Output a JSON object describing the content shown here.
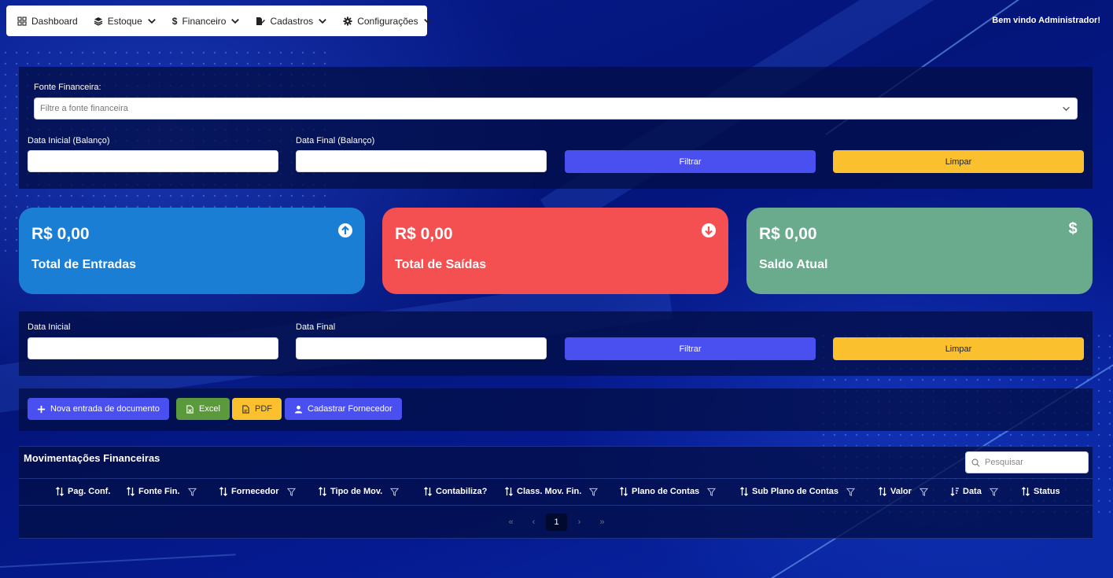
{
  "nav": {
    "items": [
      {
        "label": "Dashboard",
        "icon": "grid-icon"
      },
      {
        "label": "Estoque",
        "icon": "layers-icon"
      },
      {
        "label": "Financeiro",
        "icon": "dollar-icon"
      },
      {
        "label": "Cadastros",
        "icon": "file-edit-icon"
      },
      {
        "label": "Configurações",
        "icon": "gear-icon"
      }
    ],
    "welcome": "Bem vindo Administrador!"
  },
  "balance_filter": {
    "source_label": "Fonte Financeira:",
    "source_placeholder": "Filtre a fonte financeira",
    "start_label": "Data Inicial (Balanço)",
    "end_label": "Data Final (Balanço)",
    "filter_button": "Filtrar",
    "clear_button": "Limpar"
  },
  "cards": [
    {
      "amount": "R$ 0,00",
      "title": "Total de Entradas",
      "icon": "arrow-up-circle-icon",
      "color": "#1a7fd4"
    },
    {
      "amount": "R$ 0,00",
      "title": "Total de Saídas",
      "icon": "arrow-down-circle-icon",
      "color": "#f44f51"
    },
    {
      "amount": "R$ 0,00",
      "title": "Saldo Atual",
      "icon": "dollar-icon",
      "color": "#6aab8e"
    }
  ],
  "date_filter": {
    "start_label": "Data Inicial",
    "end_label": "Data Final",
    "filter_button": "Filtrar",
    "clear_button": "Limpar"
  },
  "actions": {
    "new_doc": "Nova entrada de documento",
    "excel": "Excel",
    "pdf": "PDF",
    "supplier": "Cadastrar Fornecedor"
  },
  "table": {
    "title": "Movimentações Financeiras",
    "search_placeholder": "Pesquisar",
    "columns": [
      {
        "label": "Pag. Conf.",
        "filter": false,
        "sort": "both"
      },
      {
        "label": "Fonte Fin.",
        "filter": true,
        "sort": "both"
      },
      {
        "label": "Fornecedor",
        "filter": true,
        "sort": "both"
      },
      {
        "label": "Tipo de Mov.",
        "filter": true,
        "sort": "both"
      },
      {
        "label": "Contabiliza?",
        "filter": false,
        "sort": "both"
      },
      {
        "label": "Class. Mov. Fin.",
        "filter": true,
        "sort": "both"
      },
      {
        "label": "Plano de Contas",
        "filter": true,
        "sort": "both"
      },
      {
        "label": "Sub Plano de Contas",
        "filter": true,
        "sort": "both"
      },
      {
        "label": "Valor",
        "filter": true,
        "sort": "both"
      },
      {
        "label": "Data",
        "filter": true,
        "sort": "desc"
      },
      {
        "label": "Status",
        "filter": false,
        "sort": "both"
      }
    ],
    "pagination": {
      "first": "«",
      "prev": "‹",
      "current": "1",
      "next": "›",
      "last": "»"
    }
  }
}
